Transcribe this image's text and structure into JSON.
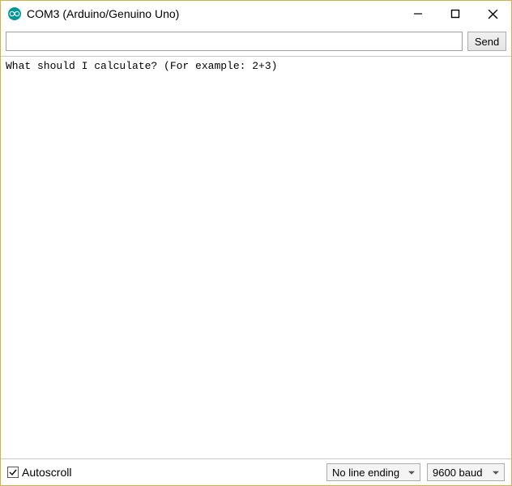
{
  "window": {
    "title": "COM3 (Arduino/Genuino Uno)"
  },
  "input": {
    "value": "",
    "send_label": "Send"
  },
  "output": {
    "text": "What should I calculate? (For example: 2+3)"
  },
  "bottom": {
    "autoscroll_label": "Autoscroll",
    "autoscroll_checked": true,
    "line_ending": "No line ending",
    "baud": "9600 baud"
  }
}
